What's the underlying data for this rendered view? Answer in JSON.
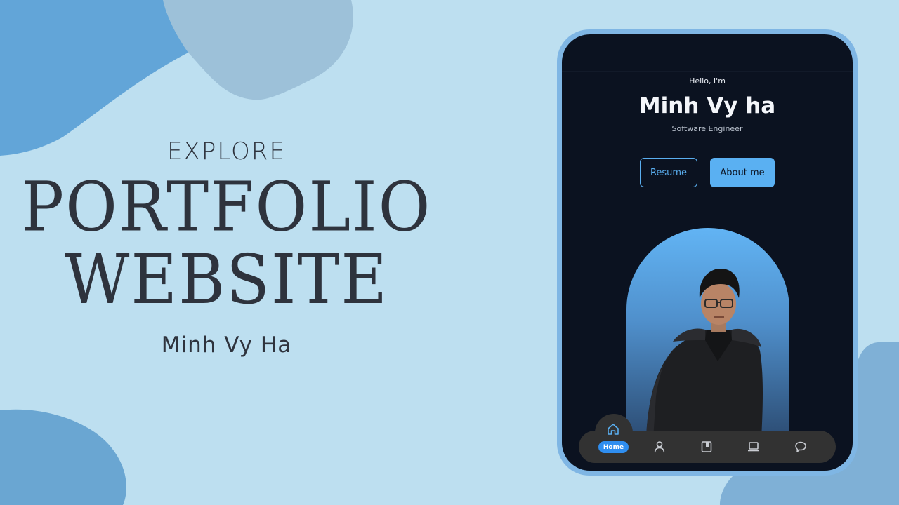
{
  "colors": {
    "background": "#bddff0",
    "blob_dark": "#62a5d8",
    "blob_gray": "#9dc1d9",
    "blob_bottom_left": "#6aa6d2",
    "blob_bottom_right": "#7fb0d6",
    "hero_text": "#2e333d",
    "tablet_frame": "#7fb6e4",
    "screen_bg": "#0b1220",
    "accent": "#5ab0f2",
    "nav_bg": "#323232",
    "nav_active": "#2f8ef0"
  },
  "hero": {
    "eyebrow": "EXPLORE",
    "title_line1": "PORTFOLIO",
    "title_line2": "WEBSITE",
    "author": "Minh Vy Ha"
  },
  "site": {
    "greeting": "Hello, I'm",
    "name": "Minh Vy ha",
    "role": "Software Engineer",
    "buttons": {
      "resume": "Resume",
      "about": "About me"
    },
    "nav": {
      "items": [
        {
          "label": "Home",
          "icon": "home-icon",
          "active": true
        },
        {
          "icon": "user-icon"
        },
        {
          "icon": "book-icon"
        },
        {
          "icon": "laptop-icon"
        },
        {
          "icon": "chat-icon"
        }
      ]
    }
  }
}
